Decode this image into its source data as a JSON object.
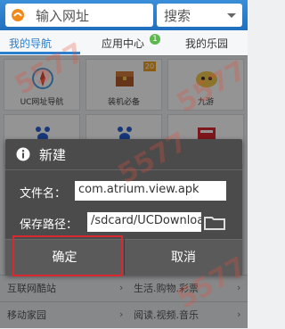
{
  "topbar": {
    "url_placeholder": "输入网址",
    "search_label": "搜索"
  },
  "tabs": [
    {
      "label": "我的导航",
      "active": true
    },
    {
      "label": "应用中心",
      "badge": "1"
    },
    {
      "label": "我的乐园"
    }
  ],
  "grid": [
    {
      "label": "UC网址导航",
      "icon": "compass-icon"
    },
    {
      "label": "装机必备",
      "icon": "treasure-chest-icon",
      "badge": "20"
    },
    {
      "label": "九游",
      "icon": "nine-game-logo-icon"
    },
    {
      "label": "",
      "icon": "paw-icon"
    },
    {
      "label": "",
      "icon": "paw-icon"
    },
    {
      "label": "",
      "icon": "news-icon"
    }
  ],
  "bottom_list": [
    {
      "left": "互联网酷站",
      "right": "生活.购物.彩票"
    },
    {
      "left": "移动家园",
      "right": "阅读.视频.音乐"
    }
  ],
  "dialog": {
    "title": "新建",
    "filename_label": "文件名：",
    "filename_value": "com.atrium.view.apk",
    "path_label": "保存路径：",
    "path_value": "/sdcard/UCDownloads",
    "ok_label": "确定",
    "cancel_label": "取消"
  },
  "watermark": "5577",
  "colors": {
    "accent": "#2a7fcf",
    "highlight": "#d9282f",
    "dialog_bg": "#4b4b4b"
  }
}
